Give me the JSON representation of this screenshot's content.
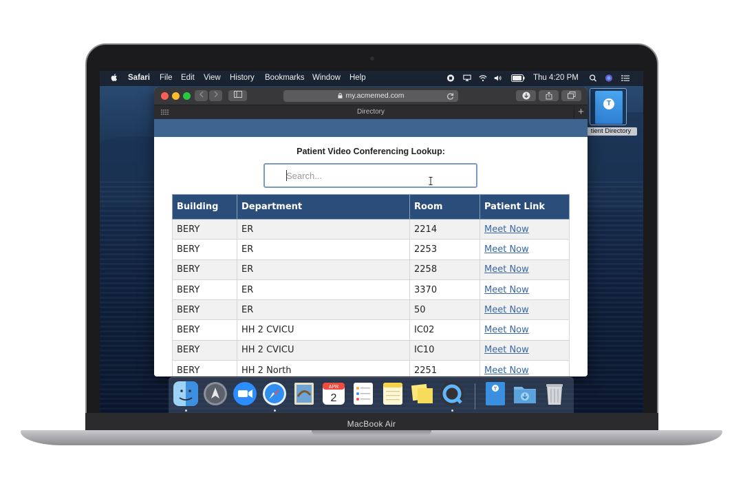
{
  "device": {
    "model": "MacBook Air"
  },
  "menubar": {
    "app_name": "Safari",
    "menus": [
      "File",
      "Edit",
      "View",
      "History",
      "Bookmarks",
      "Window",
      "Help"
    ],
    "clock": "Thu 4:20 PM"
  },
  "browser": {
    "url": "my.acmemed.com",
    "tab_title": "Directory"
  },
  "page": {
    "title": "Patient Video Conferencing Lookup:",
    "search_placeholder": "Search...",
    "table": {
      "columns": [
        "Building",
        "Department",
        "Room",
        "Patient Link"
      ],
      "rows": [
        [
          "BERY",
          "ER",
          "2214",
          "Meet Now"
        ],
        [
          "BERY",
          "ER",
          "2253",
          "Meet Now"
        ],
        [
          "BERY",
          "ER",
          "2258",
          "Meet Now"
        ],
        [
          "BERY",
          "ER",
          "3370",
          "Meet Now"
        ],
        [
          "BERY",
          "ER",
          "50",
          "Meet Now"
        ],
        [
          "BERY",
          "HH 2 CVICU",
          "IC02",
          "Meet Now"
        ],
        [
          "BERY",
          "HH 2 CVICU",
          "IC10",
          "Meet Now"
        ],
        [
          "BERY",
          "HH 2 North",
          "2251",
          "Meet Now"
        ]
      ]
    }
  },
  "desktop": {
    "icon_label": "tient Directory"
  },
  "dock": {
    "apps": [
      "finder-icon",
      "launchpad-icon",
      "zoom-icon",
      "safari-icon",
      "mail-icon",
      "calendar-icon",
      "reminders-icon",
      "notes-icon",
      "stickies-icon",
      "quicktime-icon"
    ],
    "calendar_month": "APR",
    "calendar_day": "2",
    "right": [
      "directory-doc-icon",
      "downloads-folder-icon",
      "trash-icon"
    ]
  },
  "colors": {
    "header_band": "#3e6590",
    "table_header": "#2b4d79",
    "link": "#3a67a6",
    "search_border": "#7a9ac6"
  }
}
